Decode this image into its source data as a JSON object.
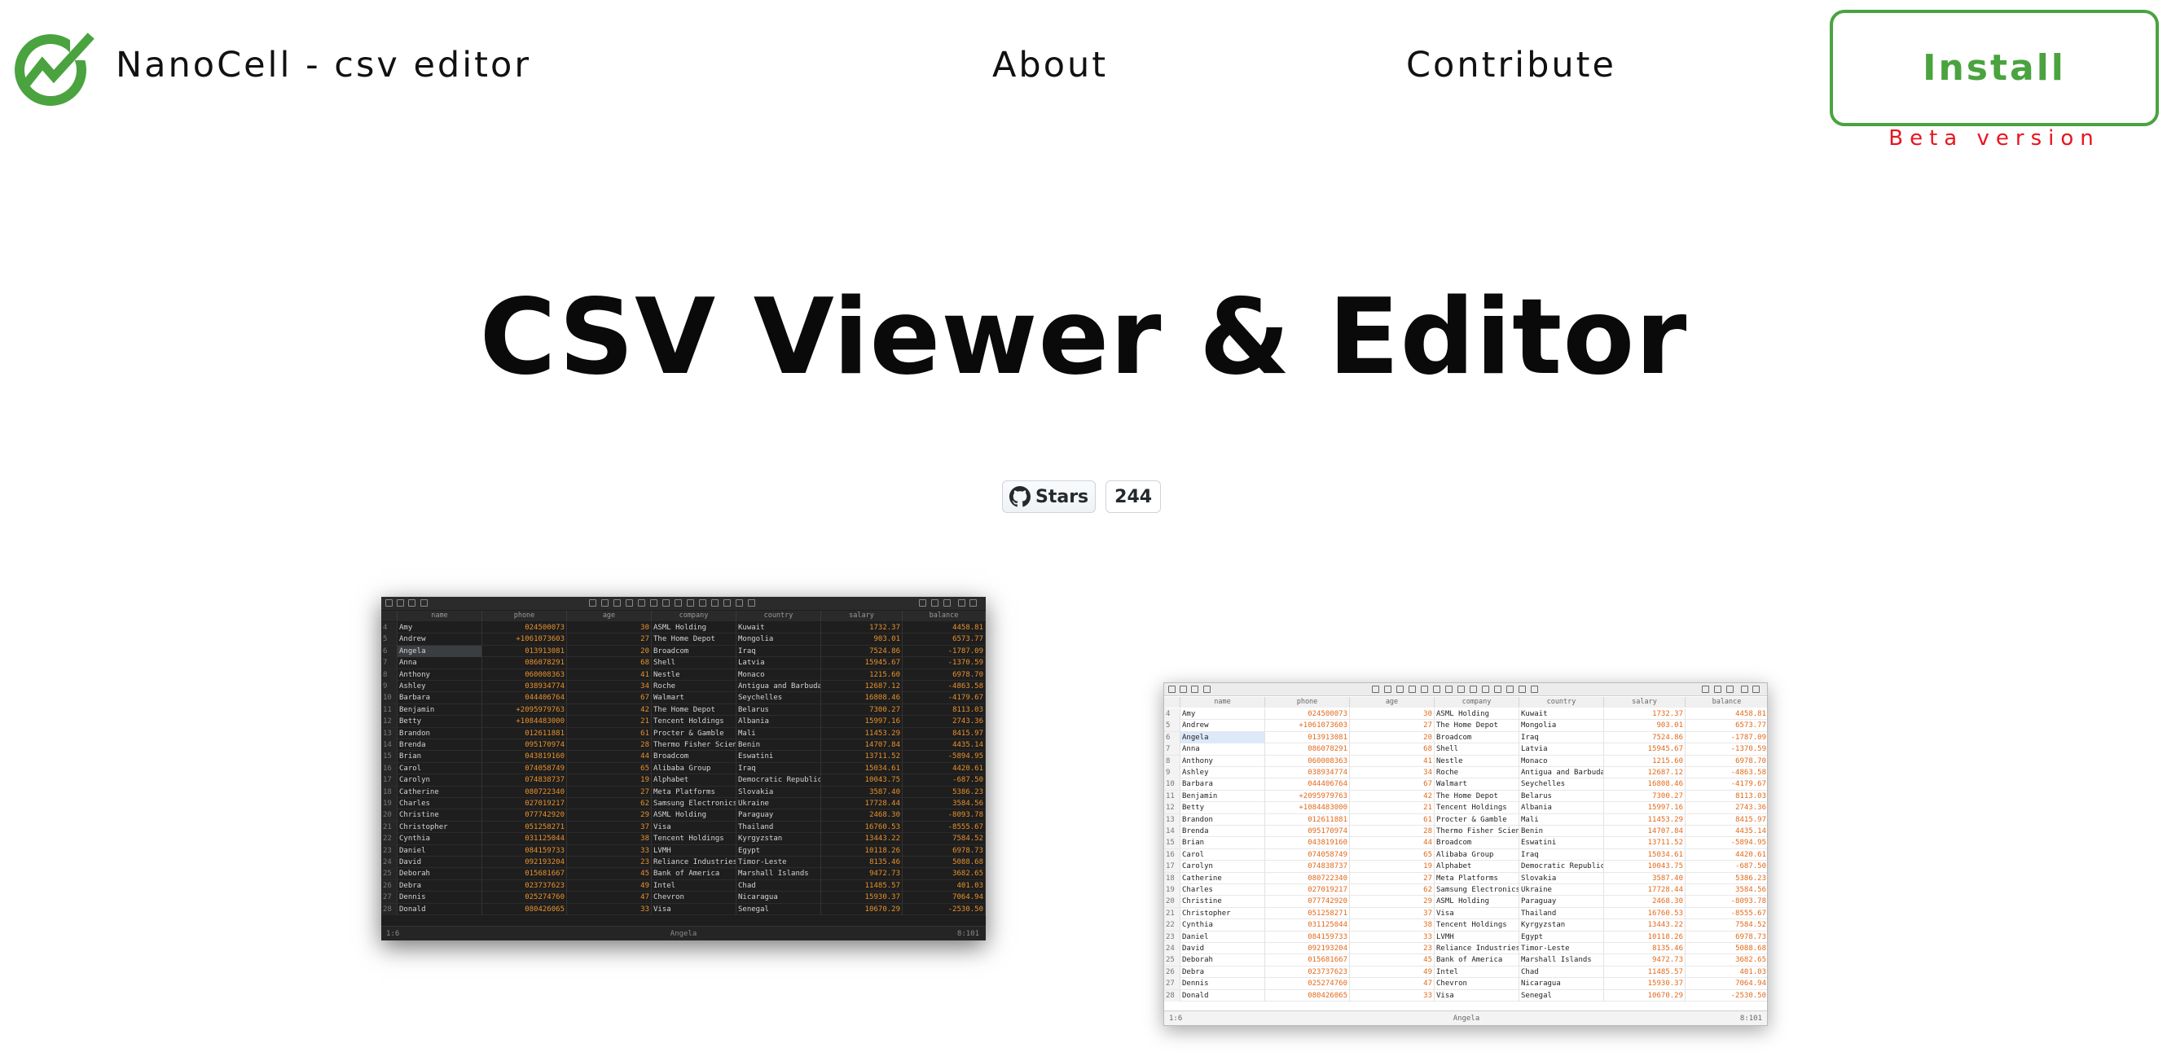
{
  "nav": {
    "brand": "NanoCell - csv editor",
    "about": "About",
    "contribute": "Contribute",
    "install": "Install",
    "beta": "Beta version"
  },
  "hero": {
    "title": "CSV Viewer & Editor"
  },
  "github": {
    "stars_label": "Stars",
    "stars_count": "244"
  },
  "colors": {
    "accent": "#4aa33f",
    "beta": "#e8141e"
  },
  "sheet": {
    "columns": [
      "name",
      "phone",
      "age",
      "company",
      "country",
      "salary",
      "balance"
    ],
    "rows": [
      [
        "4",
        "Amy",
        "024500073",
        "30",
        "ASML Holding",
        "Kuwait",
        "1732.37",
        "4458.81"
      ],
      [
        "5",
        "Andrew",
        "+1061073603",
        "27",
        "The Home Depot",
        "Mongolia",
        "903.01",
        "6573.77"
      ],
      [
        "6",
        "Angela",
        "013913081",
        "20",
        "Broadcom",
        "Iraq",
        "7524.86",
        "-1787.09"
      ],
      [
        "7",
        "Anna",
        "086078291",
        "68",
        "Shell",
        "Latvia",
        "15945.67",
        "-1370.59"
      ],
      [
        "8",
        "Anthony",
        "060008363",
        "41",
        "Nestle",
        "Monaco",
        "1215.60",
        "6978.70"
      ],
      [
        "9",
        "Ashley",
        "038934774",
        "34",
        "Roche",
        "Antigua and Barbuda",
        "12687.12",
        "-4863.58"
      ],
      [
        "10",
        "Barbara",
        "044406764",
        "67",
        "Walmart",
        "Seychelles",
        "16808.46",
        "-4179.67"
      ],
      [
        "11",
        "Benjamin",
        "+2095979763",
        "42",
        "The Home Depot",
        "Belarus",
        "7300.27",
        "8113.03"
      ],
      [
        "12",
        "Betty",
        "+1084483000",
        "21",
        "Tencent Holdings",
        "Albania",
        "15997.16",
        "2743.36"
      ],
      [
        "13",
        "Brandon",
        "012611881",
        "61",
        "Procter & Gamble",
        "Mali",
        "11453.29",
        "8415.97"
      ],
      [
        "14",
        "Brenda",
        "095170974",
        "28",
        "Thermo Fisher Scientific",
        "Benin",
        "14707.84",
        "4435.14"
      ],
      [
        "15",
        "Brian",
        "043819160",
        "44",
        "Broadcom",
        "Eswatini",
        "13711.52",
        "-5894.95"
      ],
      [
        "16",
        "Carol",
        "074058749",
        "65",
        "Alibaba Group",
        "Iraq",
        "15034.61",
        "4420.61"
      ],
      [
        "17",
        "Carolyn",
        "074838737",
        "19",
        "Alphabet",
        "Democratic Republic",
        "10043.75",
        "-687.50"
      ],
      [
        "18",
        "Catherine",
        "080722340",
        "27",
        "Meta Platforms",
        "Slovakia",
        "3587.40",
        "5386.23"
      ],
      [
        "19",
        "Charles",
        "027019217",
        "62",
        "Samsung Electronics",
        "Ukraine",
        "17728.44",
        "3584.56"
      ],
      [
        "20",
        "Christine",
        "077742920",
        "29",
        "ASML Holding",
        "Paraguay",
        "2468.30",
        "-8093.78"
      ],
      [
        "21",
        "Christopher",
        "051258271",
        "37",
        "Visa",
        "Thailand",
        "16760.53",
        "-8555.67"
      ],
      [
        "22",
        "Cynthia",
        "031125044",
        "38",
        "Tencent Holdings",
        "Kyrgyzstan",
        "13443.22",
        "7584.52"
      ],
      [
        "23",
        "Daniel",
        "084159733",
        "33",
        "LVMH",
        "Egypt",
        "10118.26",
        "6978.73"
      ],
      [
        "24",
        "David",
        "092193204",
        "23",
        "Reliance Industries",
        "Timor-Leste",
        "8135.46",
        "5088.68"
      ],
      [
        "25",
        "Deborah",
        "015681667",
        "45",
        "Bank of America",
        "Marshall Islands",
        "9472.73",
        "3682.65"
      ],
      [
        "26",
        "Debra",
        "023737623",
        "49",
        "Intel",
        "Chad",
        "11485.57",
        "401.03"
      ],
      [
        "27",
        "Dennis",
        "025274760",
        "47",
        "Chevron",
        "Nicaragua",
        "15930.37",
        "7064.94"
      ],
      [
        "28",
        "Donald",
        "080426065",
        "33",
        "Visa",
        "Senegal",
        "10670.29",
        "-2530.50"
      ]
    ],
    "status_left": "1:6",
    "status_center": "Angela",
    "status_right": "8:101"
  }
}
